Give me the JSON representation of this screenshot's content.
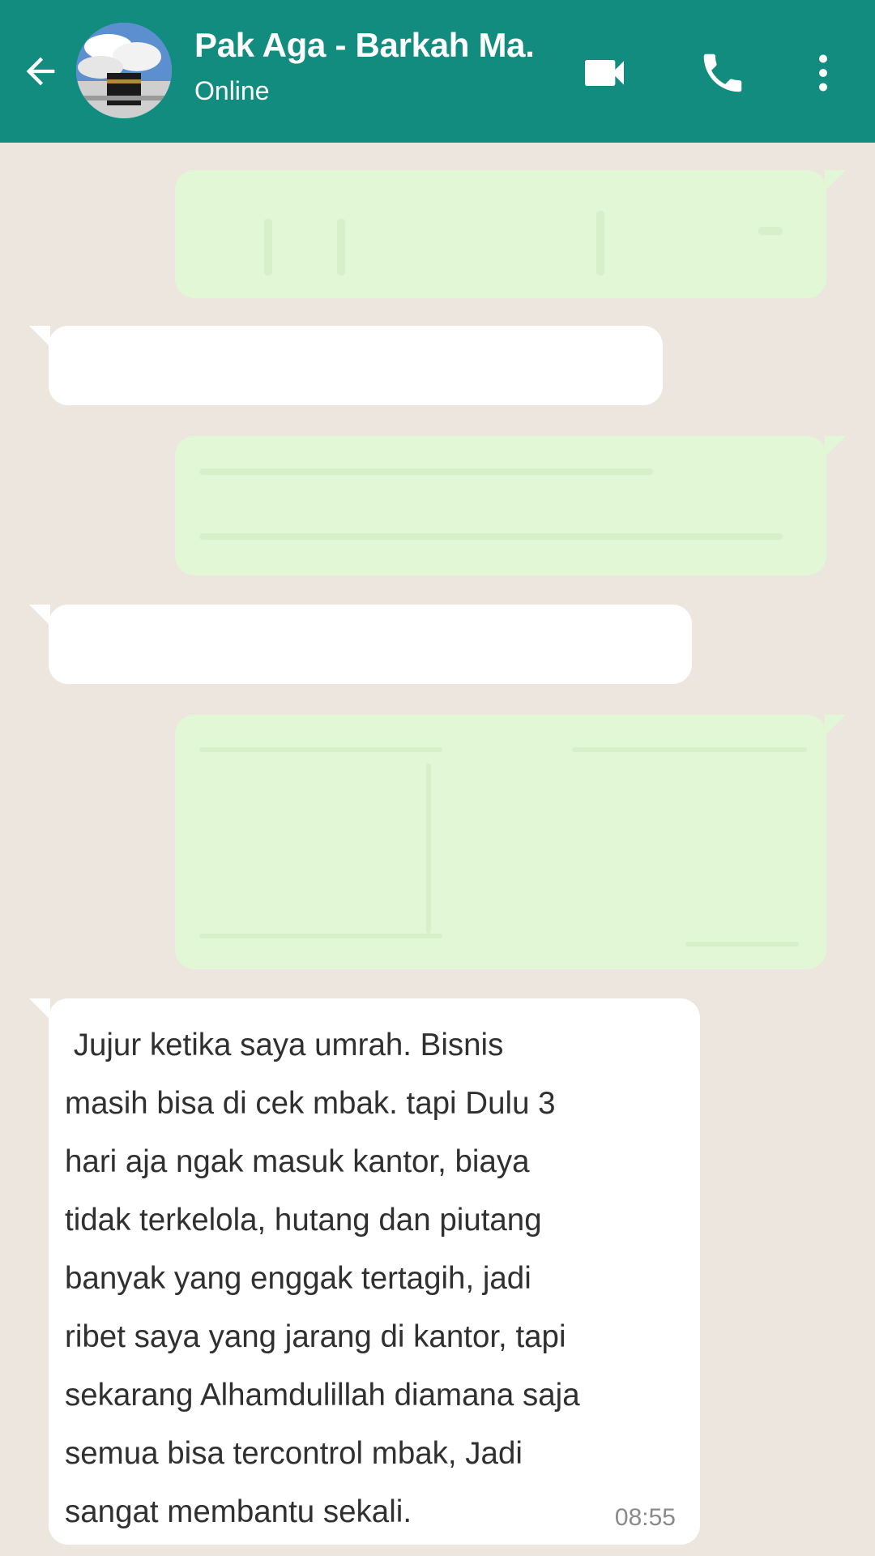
{
  "header": {
    "contact_name": "Pak Aga - Barkah Ma.",
    "status": "Online",
    "bg_color": "#128c7e"
  },
  "icons": {
    "back": "arrow-left",
    "video": "video-camera",
    "call": "phone",
    "menu": "more-vertical"
  },
  "messages": [
    {
      "direction": "outgoing",
      "text": "",
      "time": ""
    },
    {
      "direction": "incoming",
      "text": "",
      "time": ""
    },
    {
      "direction": "outgoing",
      "text": "",
      "time": ""
    },
    {
      "direction": "incoming",
      "text": "",
      "time": ""
    },
    {
      "direction": "outgoing",
      "text": "",
      "time": ""
    },
    {
      "direction": "incoming",
      "text": " Jujur ketika saya umrah. Bisnis\nmasih bisa di cek mbak. tapi Dulu 3\nhari aja ngak masuk kantor, biaya\ntidak terkelola, hutang dan piutang\nbanyak yang enggak tertagih, jadi\nribet saya yang jarang di kantor, tapi\nsekarang Alhamdulillah diamana saja\nsemua bisa tercontrol mbak, Jadi\nsangat membantu sekali.",
      "time": "08:55"
    }
  ],
  "colors": {
    "chat_bg": "#ede6df",
    "outgoing_bubble": "#e2f7d6",
    "incoming_bubble": "#ffffff"
  }
}
